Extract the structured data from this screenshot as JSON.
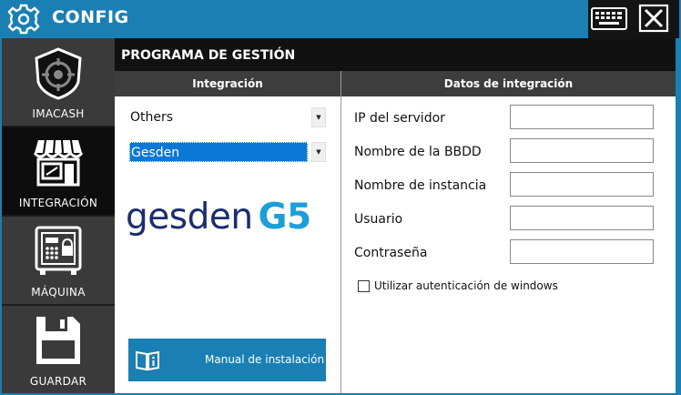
{
  "window": {
    "title": "CONFIG",
    "title_icon": "gear-icon",
    "buttons": {
      "keyboard_icon": "keyboard-icon",
      "close_icon": "close-icon"
    }
  },
  "sidebar": {
    "items": [
      {
        "label": "IMACASH",
        "icon": "shield-target-icon",
        "active": false
      },
      {
        "label": "INTEGRACIÓN",
        "icon": "storefront-icon",
        "active": true
      },
      {
        "label": "MÁQUINA",
        "icon": "safe-machine-icon",
        "active": false
      },
      {
        "label": "GUARDAR",
        "icon": "floppy-disk-icon",
        "active": false
      }
    ]
  },
  "main": {
    "section_title": "PROGRAMA DE GESTIÓN",
    "integration": {
      "header": "Integración",
      "dropdown1_value": "Others",
      "dropdown2_value": "Gesden",
      "logo": {
        "word": "gesden",
        "mark": "G5",
        "word_color": "#1b2d6e",
        "mark_color": "#1c9ed8"
      },
      "manual_button_label": "Manual de instalación",
      "manual_button_icon": "book-info-icon"
    },
    "data": {
      "header": "Datos de integración",
      "fields": [
        {
          "label": "IP del servidor",
          "value": ""
        },
        {
          "label": "Nombre de la BBDD",
          "value": ""
        },
        {
          "label": "Nombre de instancia",
          "value": ""
        },
        {
          "label": "Usuario",
          "value": ""
        },
        {
          "label": "Contraseña",
          "value": ""
        }
      ],
      "windows_auth_label": "Utilizar autenticación de windows",
      "windows_auth_checked": false
    }
  },
  "colors": {
    "accent": "#1a7fb3",
    "sidebar": "#3a3a3a",
    "sidebar_active": "#0d0d0d",
    "header_dark": "#111111",
    "selection": "#0a78d4"
  }
}
